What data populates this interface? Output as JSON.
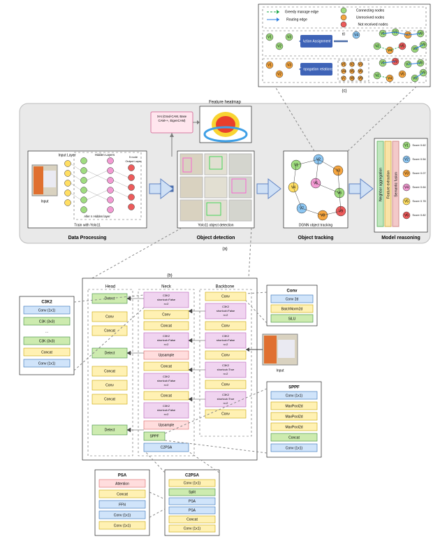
{
  "page": {
    "labels": {
      "feature_heatmap": "Feature heatmap",
      "data_processing": "Data Processing",
      "object_detection": "Object detection",
      "object_tracking": "Object tracking",
      "model_reasoning": "Model reasoning",
      "yolo_detect": "Yolo11 object detection",
      "dgnn_track": "DGNN object tracking",
      "train_with_yolo": "Train with Yolo11",
      "input": "Input",
      "input_layer": "Input Layer",
      "hidden_layers": "Hidden Layers",
      "output_layer": "5 node\nOutput Layer",
      "allnm": "Aller n Hidden layer",
      "xai": "XAI (Grad-CAM, Base\nCAM++, EigenCAM)",
      "panel_a": "(a)",
      "panel_b": "(b)",
      "panel_c": "(c)",
      "head": "Head",
      "neck": "Neck",
      "backbone": "Backbone"
    },
    "reasoning": {
      "cols": [
        "Neighbor aggregation",
        "Feature extraction",
        "Semantic fusion"
      ],
      "scores": [
        {
          "v": "V1",
          "label": "Score 0.62"
        },
        {
          "v": "V2",
          "label": "Score 0.54"
        },
        {
          "v": "V3",
          "label": "Score 0.07"
        },
        {
          "v": "V4",
          "label": "Score 0.64"
        },
        {
          "v": "V5",
          "label": "Score 0.78"
        },
        {
          "v": "V6",
          "label": "Score 0.82"
        }
      ]
    },
    "legend_c": {
      "greedy": "Greedy manage edge",
      "routing": "Routing edge",
      "connecting": "Connecting nodes",
      "unreceived": "Unreceived nodes",
      "notreceived": "Not received nodes"
    },
    "c_arrows": {
      "action_assignment": "Action Assignment",
      "propagation_relations": "Propagation relations"
    },
    "c_nodes": [
      "V1",
      "V2",
      "V3",
      "V4",
      "V5",
      "V6",
      "V7",
      "V8",
      "V9"
    ],
    "b_modules": {
      "conv": {
        "title": "Conv",
        "items": [
          "Conv 2d",
          "BatchNorm2d",
          "SiLU"
        ]
      },
      "sppf": {
        "title": "SPPF",
        "items": [
          "Conv (1x1)",
          "MaxPool2d",
          "MaxPool2d",
          "MaxPool2d",
          "Concat",
          "Conv (1x1)"
        ]
      },
      "c3k2": {
        "title": "C3K2",
        "items": [
          "Conv (1x1)",
          "C3K (3x3)",
          "…",
          "C3K (3x3)",
          "Concat",
          "Conv (1x1)"
        ]
      },
      "psa": {
        "title": "PSA",
        "items": [
          "Attention",
          "Concat",
          "FFN",
          "Conv (1x1)",
          "Conv (1x1)"
        ]
      },
      "c2psa": {
        "title": "C2PSA",
        "items": [
          "Conv (1x1)",
          "Split",
          "PSA",
          "PSA",
          "Concat",
          "Conv (1x1)"
        ]
      },
      "head_col": [
        "Detect",
        "Conv",
        "Concat",
        "Detect",
        "Concat",
        "Conv",
        "Concat",
        "Detect"
      ],
      "neck_col": [
        "C3K2\nshortcut=False\nn=2",
        "Conv",
        "Concat",
        "C3K2\nshortcut=False\nn=2",
        "Upsample",
        "Concat",
        "C3K2\nshortcut=False\nn=2",
        "Upsample",
        "SPPF",
        "C2PSA"
      ],
      "backbone_col": [
        "Conv",
        "C3K2\nshortcut=False\nn=2",
        "Conv",
        "C3K2\nshortcut=False\nn=2",
        "Conv",
        "C3K2\nshortcut=True\nn=2",
        "Conv",
        "C3K2\nshortcut=True\nn=2",
        "Conv"
      ]
    }
  }
}
